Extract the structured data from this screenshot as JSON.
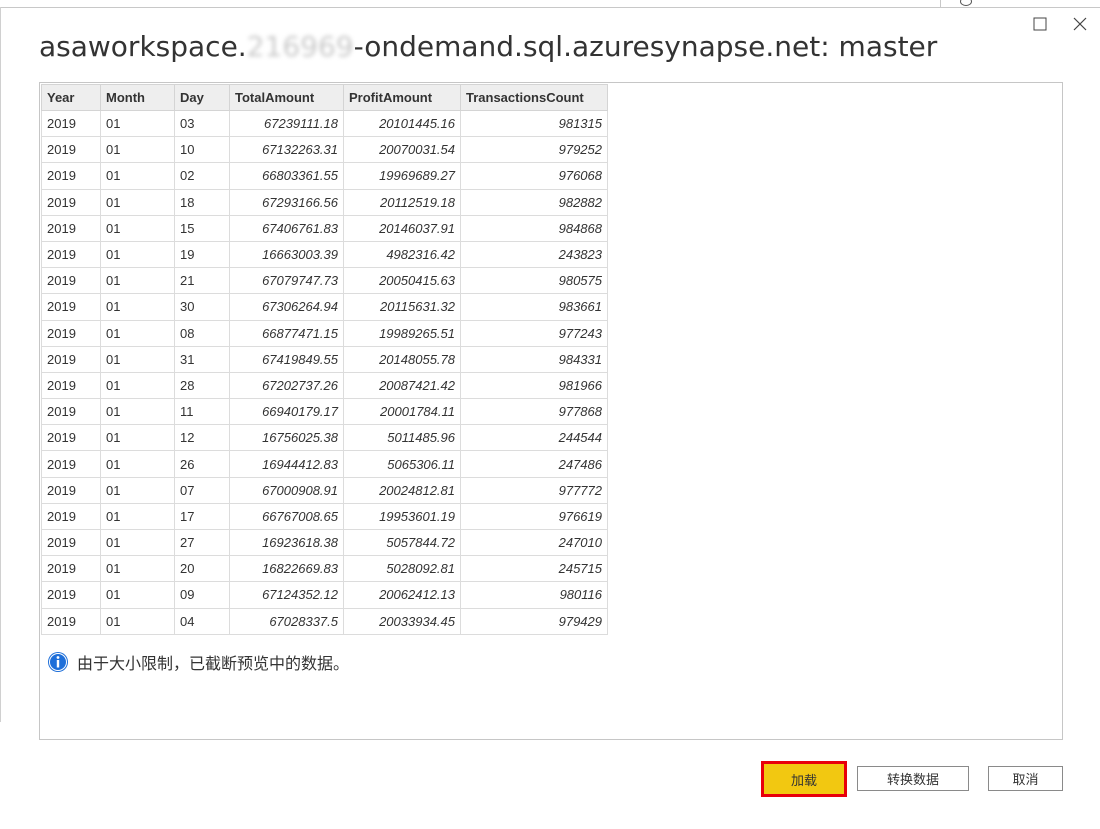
{
  "title": {
    "prefix": "asaworkspace.",
    "redacted": "216969",
    "suffix": "-ondemand.sql.azuresynapse.net: master"
  },
  "table": {
    "columns": [
      "Year",
      "Month",
      "Day",
      "TotalAmount",
      "ProfitAmount",
      "TransactionsCount"
    ],
    "rows": [
      [
        "2019",
        "01",
        "03",
        "67239111.18",
        "20101445.16",
        "981315"
      ],
      [
        "2019",
        "01",
        "10",
        "67132263.31",
        "20070031.54",
        "979252"
      ],
      [
        "2019",
        "01",
        "02",
        "66803361.55",
        "19969689.27",
        "976068"
      ],
      [
        "2019",
        "01",
        "18",
        "67293166.56",
        "20112519.18",
        "982882"
      ],
      [
        "2019",
        "01",
        "15",
        "67406761.83",
        "20146037.91",
        "984868"
      ],
      [
        "2019",
        "01",
        "19",
        "16663003.39",
        "4982316.42",
        "243823"
      ],
      [
        "2019",
        "01",
        "21",
        "67079747.73",
        "20050415.63",
        "980575"
      ],
      [
        "2019",
        "01",
        "30",
        "67306264.94",
        "20115631.32",
        "983661"
      ],
      [
        "2019",
        "01",
        "08",
        "66877471.15",
        "19989265.51",
        "977243"
      ],
      [
        "2019",
        "01",
        "31",
        "67419849.55",
        "20148055.78",
        "984331"
      ],
      [
        "2019",
        "01",
        "28",
        "67202737.26",
        "20087421.42",
        "981966"
      ],
      [
        "2019",
        "01",
        "11",
        "66940179.17",
        "20001784.11",
        "977868"
      ],
      [
        "2019",
        "01",
        "12",
        "16756025.38",
        "5011485.96",
        "244544"
      ],
      [
        "2019",
        "01",
        "26",
        "16944412.83",
        "5065306.11",
        "247486"
      ],
      [
        "2019",
        "01",
        "07",
        "67000908.91",
        "20024812.81",
        "977772"
      ],
      [
        "2019",
        "01",
        "17",
        "66767008.65",
        "19953601.19",
        "976619"
      ],
      [
        "2019",
        "01",
        "27",
        "16923618.38",
        "5057844.72",
        "247010"
      ],
      [
        "2019",
        "01",
        "20",
        "16822669.83",
        "5028092.81",
        "245715"
      ],
      [
        "2019",
        "01",
        "09",
        "67124352.12",
        "20062412.13",
        "980116"
      ],
      [
        "2019",
        "01",
        "04",
        "67028337.5",
        "20033934.45",
        "979429"
      ]
    ]
  },
  "info": {
    "icon": "info-icon",
    "message": "由于大小限制，已截断预览中的数据。"
  },
  "buttons": {
    "load": "加载",
    "transform": "转换数据",
    "cancel": "取消"
  },
  "colors": {
    "load_bg": "#f2c811",
    "load_highlight_border": "#e8000b",
    "info_icon": "#1e6fd9"
  }
}
